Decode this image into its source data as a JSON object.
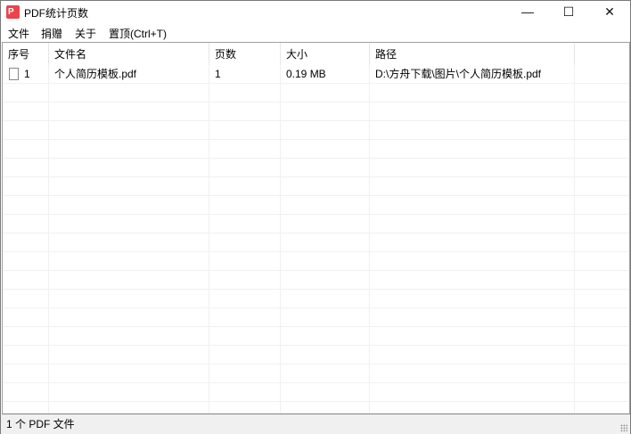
{
  "window": {
    "title": "PDF统计页数",
    "app_icon_label": "P",
    "minimize": "—",
    "maximize": "☐",
    "close": "✕"
  },
  "menu": [
    "文件",
    "捐赠",
    "关于",
    "置顶(Ctrl+T)"
  ],
  "columns": [
    "序号",
    "文件名",
    "页数",
    "大小",
    "路径"
  ],
  "rows": [
    {
      "index": "1",
      "name": "个人简历模板.pdf",
      "pages": "1",
      "size": "0.19 MB",
      "path": "D:\\方舟下载\\图片\\个人简历模板.pdf",
      "icon": "document-icon"
    }
  ],
  "status": "1 个 PDF 文件"
}
